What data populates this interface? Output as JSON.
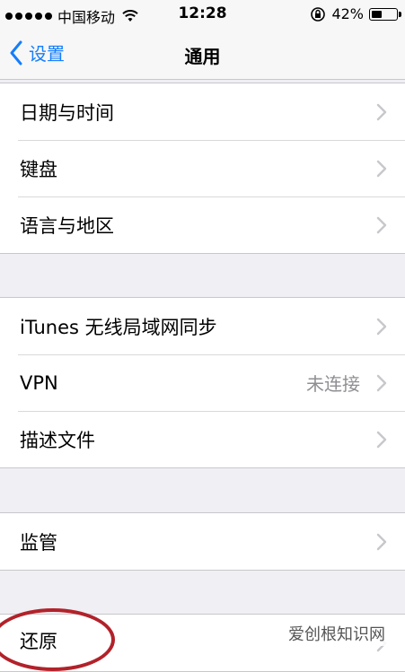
{
  "status_bar": {
    "carrier": "中国移动",
    "time": "12:28",
    "battery_percent": "42%",
    "battery_level": 0.42
  },
  "nav": {
    "back_label": "设置",
    "title": "通用"
  },
  "groups": [
    {
      "items": [
        {
          "label": "日期与时间"
        },
        {
          "label": "键盘"
        },
        {
          "label": "语言与地区"
        }
      ]
    },
    {
      "items": [
        {
          "label": "iTunes 无线局域网同步"
        },
        {
          "label": "VPN",
          "value": "未连接"
        },
        {
          "label": "描述文件"
        }
      ]
    },
    {
      "items": [
        {
          "label": "监管"
        }
      ]
    },
    {
      "items": [
        {
          "label": "还原"
        }
      ]
    }
  ],
  "watermark": "爱创根知识网",
  "colors": {
    "accent": "#157efb",
    "highlight_circle": "#b2222a",
    "background": "#efeff4"
  },
  "icons": {
    "back": "chevron-left-icon",
    "row": "chevron-right-icon"
  }
}
